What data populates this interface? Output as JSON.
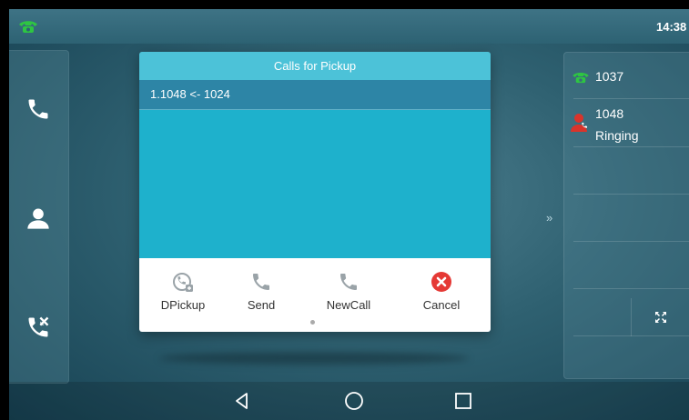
{
  "status_bar": {
    "clock": "14:38",
    "icon": "phone-handset-icon"
  },
  "sidebar": {
    "items": [
      {
        "icon": "phone-icon"
      },
      {
        "icon": "contact-icon"
      },
      {
        "icon": "call-history-icon"
      }
    ]
  },
  "dialog": {
    "title": "Calls for Pickup",
    "items": [
      "1.1048 <- 1024"
    ],
    "actions": [
      {
        "label": "DPickup",
        "icon": "directed-pickup-icon"
      },
      {
        "label": "Send",
        "icon": "phone-send-icon"
      },
      {
        "label": "NewCall",
        "icon": "new-call-icon"
      },
      {
        "label": "Cancel",
        "icon": "cancel-icon"
      }
    ]
  },
  "lines": {
    "line1": {
      "label": "1037",
      "icon": "phone-handset-icon"
    },
    "line2": {
      "label": "1048",
      "status": "Ringing",
      "icon": "ringing-contact-icon"
    }
  },
  "colors": {
    "accent": "#4cc2d8",
    "dialog_body": "#1eb1cc",
    "selected_row": "#2d85a6",
    "handset_green": "#2ec542",
    "ringing_red": "#d9342b",
    "cancel_red": "#e53935",
    "action_icon_gray": "#9aa3a8"
  }
}
